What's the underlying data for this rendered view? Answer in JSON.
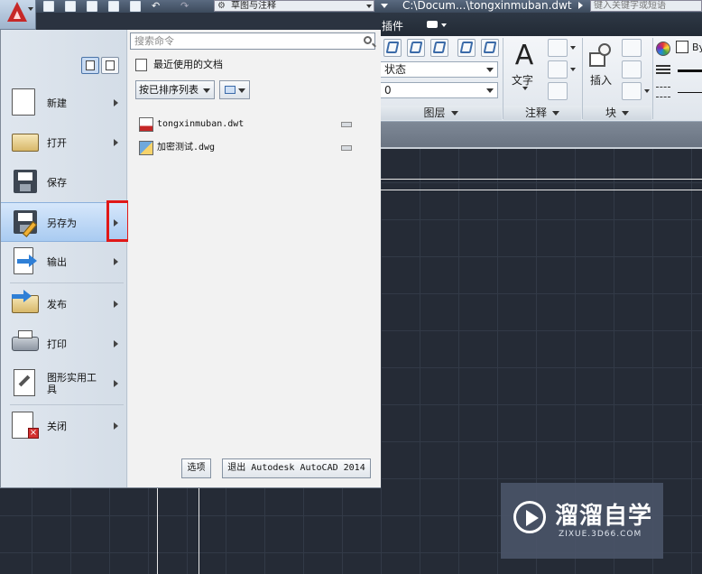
{
  "window": {
    "workspace": "草图与注释",
    "file_title": "C:\\Docum...\\tongxinmuban.dwt",
    "search_placeholder": "键入关键字或短语"
  },
  "ribbon": {
    "tab_partial": "插件",
    "layer_state_combo": "状态",
    "layer_combo": "0",
    "panels": {
      "layers": "图层",
      "annotation": "注释",
      "block": "块"
    },
    "text_label": "文字",
    "insert_label": "插入",
    "by_label": "By"
  },
  "app_menu": {
    "commands": [
      {
        "label": "新建",
        "icon": "new-icon"
      },
      {
        "label": "打开",
        "icon": "open-folder-icon"
      },
      {
        "label": "保存",
        "icon": "save-icon"
      },
      {
        "label": "另存为",
        "icon": "save-as-icon"
      },
      {
        "label": "输出",
        "icon": "export-icon"
      },
      {
        "label": "发布",
        "icon": "publish-icon"
      },
      {
        "label": "打印",
        "icon": "print-icon"
      },
      {
        "label": "图形实用工具",
        "icon": "drawing-utilities-icon"
      },
      {
        "label": "关闭",
        "icon": "close-drawing-icon"
      }
    ],
    "search_placeholder": "搜索命令",
    "recent_header": "最近使用的文档",
    "sort_by": "按已排序列表",
    "recent_files": [
      {
        "name": "tongxinmuban.dwt",
        "type": "dwt"
      },
      {
        "name": "加密测试.dwg",
        "type": "dwg"
      }
    ],
    "options_button": "选项",
    "exit_button": "退出 Autodesk AutoCAD 2014"
  },
  "watermark": {
    "title": "溜溜自学",
    "url": "ZIXUE.3D66.COM"
  }
}
